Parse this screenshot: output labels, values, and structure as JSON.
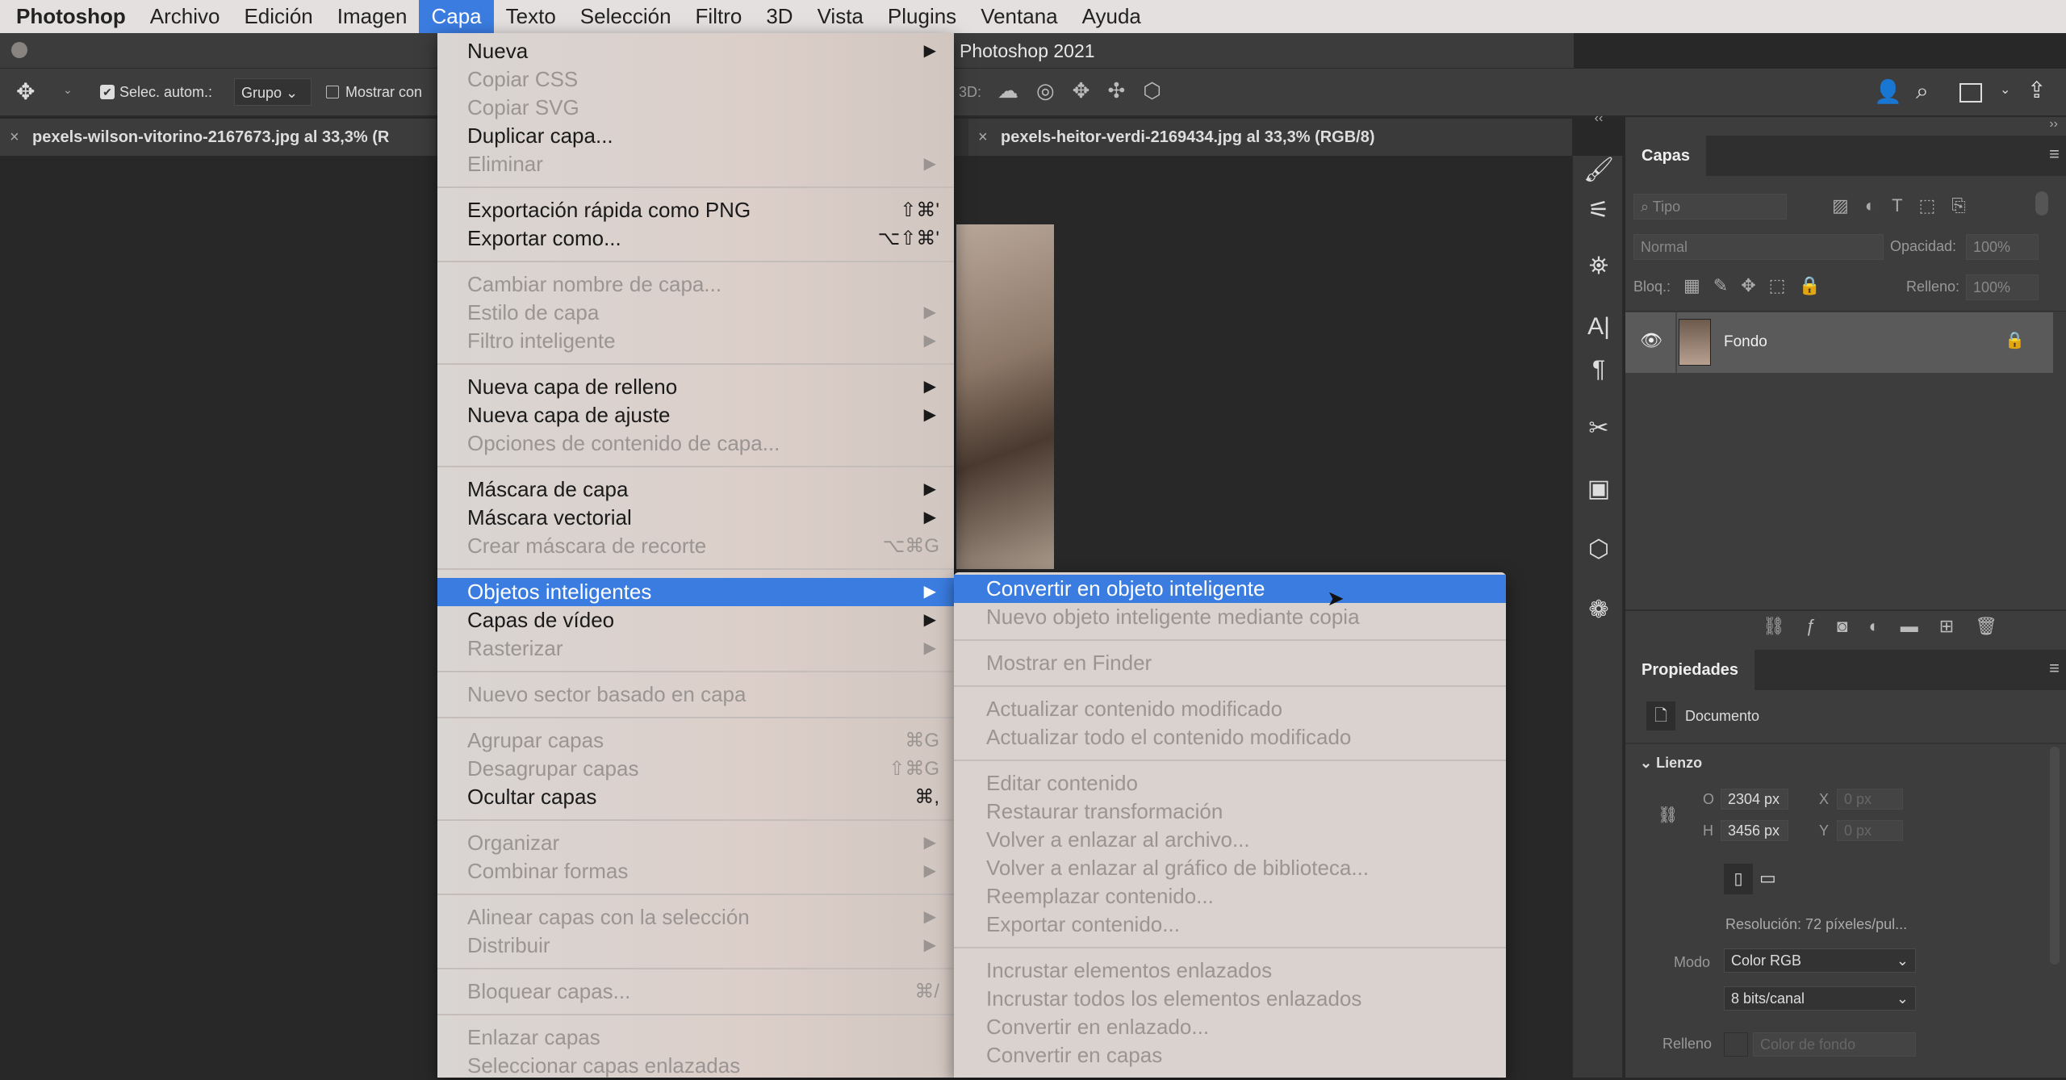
{
  "menubar": {
    "app": "Photoshop",
    "items": [
      "Archivo",
      "Edición",
      "Imagen",
      "Capa",
      "Texto",
      "Selección",
      "Filtro",
      "3D",
      "Vista",
      "Plugins",
      "Ventana",
      "Ayuda"
    ],
    "active": "Capa"
  },
  "window": {
    "title": "Photoshop 2021"
  },
  "options": {
    "auto_select_label": "Selec. autom.:",
    "auto_select_checked": true,
    "group_value": "Grupo",
    "show_label": "Mostrar con",
    "three_d_label": "3D:"
  },
  "tabs": [
    {
      "label": "pexels-wilson-vitorino-2167673.jpg al 33,3% (R"
    },
    {
      "label": "pexels-heitor-verdi-2169434.jpg al 33,3% (RGB/8)"
    }
  ],
  "capa_menu": [
    {
      "label": "Nueva",
      "arrow": true
    },
    {
      "label": "Copiar CSS",
      "disabled": true
    },
    {
      "label": "Copiar SVG",
      "disabled": true
    },
    {
      "label": "Duplicar capa..."
    },
    {
      "label": "Eliminar",
      "disabled": true,
      "arrow": true
    },
    {
      "sep": true
    },
    {
      "label": "Exportación rápida como PNG",
      "shortcut": "⇧⌘'"
    },
    {
      "label": "Exportar como...",
      "shortcut": "⌥⇧⌘'"
    },
    {
      "sep": true
    },
    {
      "label": "Cambiar nombre de capa...",
      "disabled": true
    },
    {
      "label": "Estilo de capa",
      "disabled": true,
      "arrow": true
    },
    {
      "label": "Filtro inteligente",
      "disabled": true,
      "arrow": true
    },
    {
      "sep": true
    },
    {
      "label": "Nueva capa de relleno",
      "arrow": true
    },
    {
      "label": "Nueva capa de ajuste",
      "arrow": true
    },
    {
      "label": "Opciones de contenido de capa...",
      "disabled": true
    },
    {
      "sep": true
    },
    {
      "label": "Máscara de capa",
      "arrow": true
    },
    {
      "label": "Máscara vectorial",
      "arrow": true
    },
    {
      "label": "Crear máscara de recorte",
      "disabled": true,
      "shortcut": "⌥⌘G"
    },
    {
      "sep": true
    },
    {
      "label": "Objetos inteligentes",
      "arrow": true,
      "highlighted": true
    },
    {
      "label": "Capas de vídeo",
      "arrow": true
    },
    {
      "label": "Rasterizar",
      "disabled": true,
      "arrow": true
    },
    {
      "sep": true
    },
    {
      "label": "Nuevo sector basado en capa",
      "disabled": true
    },
    {
      "sep": true
    },
    {
      "label": "Agrupar capas",
      "disabled": true,
      "shortcut": "⌘G"
    },
    {
      "label": "Desagrupar capas",
      "disabled": true,
      "shortcut": "⇧⌘G"
    },
    {
      "label": "Ocultar capas",
      "shortcut": "⌘,"
    },
    {
      "sep": true
    },
    {
      "label": "Organizar",
      "disabled": true,
      "arrow": true
    },
    {
      "label": "Combinar formas",
      "disabled": true,
      "arrow": true
    },
    {
      "sep": true
    },
    {
      "label": "Alinear capas con la selección",
      "disabled": true,
      "arrow": true
    },
    {
      "label": "Distribuir",
      "disabled": true,
      "arrow": true
    },
    {
      "sep": true
    },
    {
      "label": "Bloquear capas...",
      "disabled": true,
      "shortcut": "⌘/"
    },
    {
      "sep": true
    },
    {
      "label": "Enlazar capas",
      "disabled": true
    },
    {
      "label": "Seleccionar capas enlazadas",
      "disabled": true
    }
  ],
  "smart_objects_menu": [
    {
      "label": "Convertir en objeto inteligente",
      "highlighted": true
    },
    {
      "label": "Nuevo objeto inteligente mediante copia",
      "disabled": true
    },
    {
      "sep": true
    },
    {
      "label": "Mostrar en Finder",
      "disabled": true
    },
    {
      "sep": true
    },
    {
      "label": "Actualizar contenido modificado",
      "disabled": true
    },
    {
      "label": "Actualizar todo el contenido modificado",
      "disabled": true
    },
    {
      "sep": true
    },
    {
      "label": "Editar contenido",
      "disabled": true
    },
    {
      "label": "Restaurar transformación",
      "disabled": true
    },
    {
      "label": "Volver a enlazar al archivo...",
      "disabled": true
    },
    {
      "label": "Volver a enlazar al gráfico de biblioteca...",
      "disabled": true
    },
    {
      "label": "Reemplazar contenido...",
      "disabled": true
    },
    {
      "label": "Exportar contenido...",
      "disabled": true
    },
    {
      "sep": true
    },
    {
      "label": "Incrustar elementos enlazados",
      "disabled": true
    },
    {
      "label": "Incrustar todos los elementos enlazados",
      "disabled": true
    },
    {
      "label": "Convertir en enlazado...",
      "disabled": true
    },
    {
      "label": "Convertir en capas",
      "disabled": true
    }
  ],
  "layers": {
    "title": "Capas",
    "filter_placeholder": "Tipo",
    "blend": "Normal",
    "opacity_label": "Opacidad:",
    "opacity": "100%",
    "lock_label": "Bloq.:",
    "fill_label": "Relleno:",
    "fill": "100%",
    "items": [
      {
        "name": "Fondo",
        "visible": true,
        "locked": true
      }
    ]
  },
  "properties": {
    "title": "Propiedades",
    "doc_label": "Documento",
    "section": "Lienzo",
    "w_label": "O",
    "w": "2304 px",
    "h_label": "H",
    "h": "3456 px",
    "x_label": "X",
    "x": "0 px",
    "y_label": "Y",
    "y": "0 px",
    "resolution": "Resolución: 72 píxeles/pul...",
    "mode_label": "Modo",
    "mode": "Color RGB",
    "depth": "8 bits/canal",
    "fill_label": "Relleno",
    "fill": "Color de fondo"
  },
  "colors": {
    "accent": "#3a7ce0",
    "panel": "#3d3d3d",
    "background": "#282828"
  }
}
